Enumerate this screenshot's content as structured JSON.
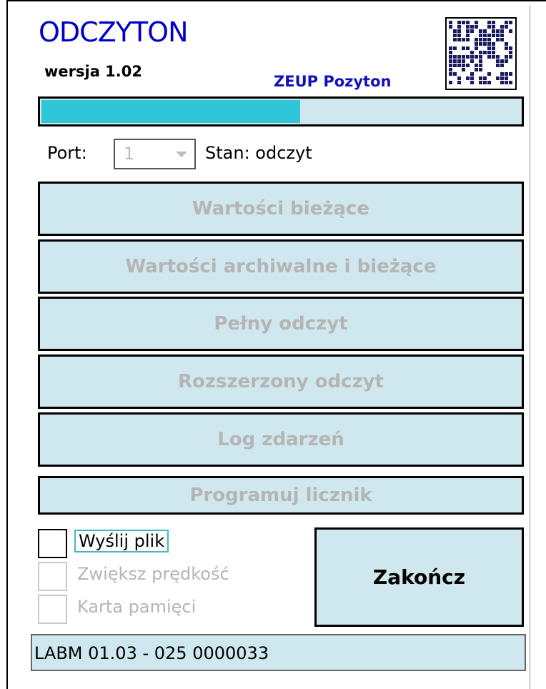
{
  "header": {
    "app_title": "ODCZYTON",
    "version": "wersja 1.02",
    "company": "ZEUP Pozyton",
    "logo_icon": "qr-code-icon"
  },
  "progress": {
    "fraction": 0.54,
    "fill_color": "#2fc6d6"
  },
  "port": {
    "label": "Port:",
    "selected": "1",
    "state": "Stan: odczyt"
  },
  "buttons": {
    "current_values": "Wartości bieżące",
    "archive_values": "Wartości archiwalne i bieżące",
    "full_read": "Pełny odczyt",
    "extended_read": "Rozszerzony odczyt",
    "event_log": "Log zdarzeń",
    "program_meter": "Programuj licznik",
    "exit": "Zakończ"
  },
  "options": {
    "send_file": "Wyślij plik",
    "increase_speed": "Zwiększ prędkość",
    "memory_card": "Karta pamięci"
  },
  "status": {
    "text": "LABM 01.03 - 025 0000033"
  },
  "colors": {
    "accent": "#cfe7ee",
    "title": "#0000c8",
    "disabled_text": "#b5b5b5"
  }
}
